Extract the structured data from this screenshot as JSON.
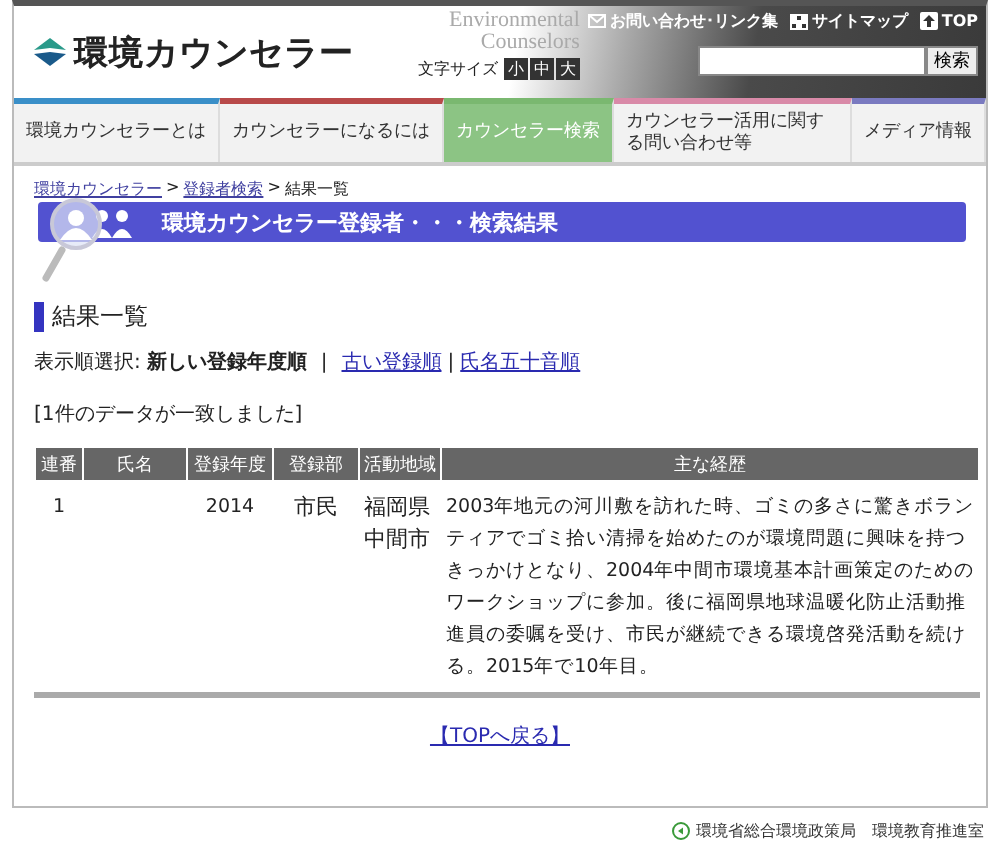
{
  "header": {
    "logo": "環境カウンセラー",
    "english_title": [
      "Environmental",
      "Counselors"
    ],
    "font_size_label": "文字サイズ",
    "font_sizes": [
      {
        "label": "小",
        "selected": false
      },
      {
        "label": "中",
        "selected": false
      },
      {
        "label": "大",
        "selected": false
      }
    ],
    "links": [
      {
        "kind": "mail",
        "label": "お問い合わせ･リンク集"
      },
      {
        "kind": "sitemap",
        "label": "サイトマップ"
      },
      {
        "kind": "top",
        "label": "TOP"
      }
    ],
    "search": {
      "button": "検索"
    }
  },
  "nav": [
    {
      "label": "環境カウンセラーとは",
      "color": "#3a8fc8",
      "selected": false
    },
    {
      "label": "カウンセラーになるには",
      "color": "#b84a4a",
      "selected": false
    },
    {
      "label": "カウンセラー検索",
      "color": "#7ab870",
      "selected": true
    },
    {
      "label": "カウンセラー活用に関する問い合わせ等",
      "color": "#d98aa8",
      "selected": false
    },
    {
      "label": "メディア情報",
      "color": "#7a7ac0",
      "selected": false
    }
  ],
  "breadcrumb_separators": [
    ">",
    ">"
  ],
  "breadcrumb": [
    {
      "label": "環境カウンセラー",
      "link": true
    },
    {
      "label": "登録者検索",
      "link": true
    },
    {
      "label": "結果一覧",
      "link": false
    }
  ],
  "banner": {
    "title": "環境カウンセラー登録者・・・検索結果"
  },
  "section_title": "結果一覧",
  "sort": {
    "label": "表示順選択:",
    "separators": [
      "|",
      "|"
    ],
    "options": [
      {
        "label": "新しい登録年度順",
        "selected": true
      },
      {
        "label": "古い登録順",
        "selected": false
      },
      {
        "label": "氏名五十音順",
        "selected": false
      }
    ]
  },
  "result_count": "[1件のデータが一致しました]",
  "table": {
    "columns": [
      "連番",
      "氏名",
      "登録年度",
      "登録部",
      "活動地域",
      "主な経歴"
    ],
    "rows": [
      {
        "no": "1",
        "year": "2014",
        "category": "市民",
        "area": "福岡県中間市",
        "history": "2003年地元の河川敷を訪れた時、ゴミの多さに驚きボランティアでゴミ拾い清掃を始めたのが環境問題に興味を持つきっかけとなり、2004年中間市環境基本計画策定のためのワークショップに参加。後に福岡県地球温暖化防止活動推進員の委嘱を受け、市民が継続できる環境啓発活動を続ける。2015年で10年目。"
      }
    ]
  },
  "back_link": "【TOPへ戻る】",
  "footer": "環境省総合環境政策局　環境教育推進室"
}
